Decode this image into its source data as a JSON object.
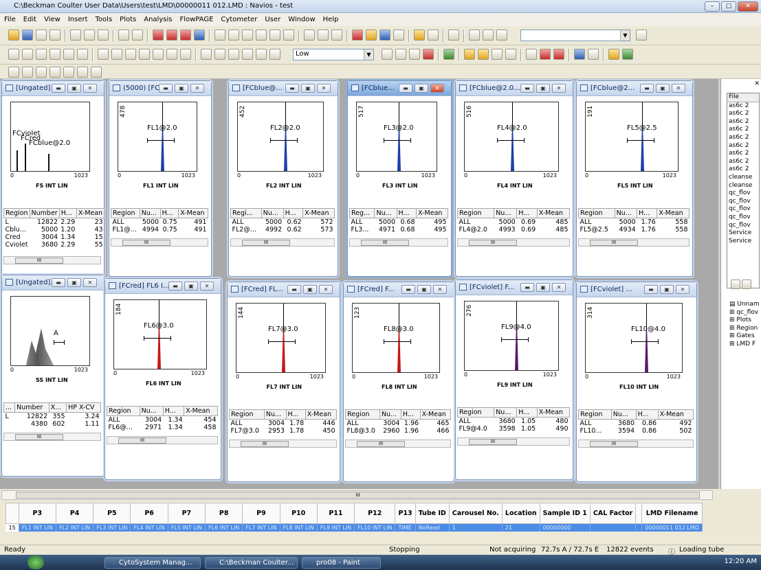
{
  "app": {
    "title": "C:\\Beckman Coulter User Data\\Users\\test\\LMD\\00000011 012.LMD : Navios - test"
  },
  "menu": [
    "File",
    "Edit",
    "View",
    "Insert",
    "Tools",
    "Plots",
    "Analysis",
    "FlowPAGE",
    "Cytometer",
    "User",
    "Window",
    "Help"
  ],
  "toolbar": {
    "speed": "Low"
  },
  "plots": [
    {
      "title": "[Ungated] ...",
      "xlabel": "FS INT LIN",
      "tick_max": "1023",
      "labels": [
        "FCviolet",
        "FCred",
        "FCblue@2.0"
      ],
      "headers": [
        "Region",
        "Number",
        "H...",
        "X-Mean"
      ],
      "rows": [
        [
          "L",
          "12822",
          "2.29",
          "23"
        ],
        [
          "Cblu...",
          "5000",
          "1.20",
          "43"
        ],
        [
          "Cred",
          "3004",
          "1.34",
          "15"
        ],
        [
          "Cviolet",
          "3680",
          "2.29",
          "55"
        ]
      ]
    },
    {
      "title": "(5000) [FCbl...",
      "ymax": "478",
      "region": "FL1@2.0",
      "xlabel": "FL1 INT LIN",
      "tick_max": "1023",
      "headers": [
        "Region",
        "Nu...",
        "H...",
        "X-Mean"
      ],
      "rows": [
        [
          "ALL",
          "5000",
          "0.75",
          "491"
        ],
        [
          "FL1@...",
          "4994",
          "0.75",
          "491"
        ]
      ],
      "color": "#1f3fa8"
    },
    {
      "title": "[FCblue@...",
      "ymax": "452",
      "region": "FL2@2.0",
      "xlabel": "FL2 INT LIN",
      "tick_max": "1023",
      "headers": [
        "Regi...",
        "Nu...",
        "H...",
        "X-Mean"
      ],
      "rows": [
        [
          "ALL",
          "5000",
          "0.62",
          "572"
        ],
        [
          "FL2@...",
          "4992",
          "0.62",
          "573"
        ]
      ],
      "color": "#1f3fa8"
    },
    {
      "title": "[FCblue...",
      "ymax": "517",
      "region": "FL3@2.0",
      "xlabel": "FL3 INT LIN",
      "tick_max": "1023",
      "headers": [
        "Reg...",
        "Nu...",
        "H...",
        "X-Mean"
      ],
      "rows": [
        [
          "ALL",
          "5000",
          "0.68",
          "495"
        ],
        [
          "FL3...",
          "4971",
          "0.68",
          "495"
        ]
      ],
      "color": "#1f3fa8"
    },
    {
      "title": "[FCblue@2.0...",
      "ymax": "516",
      "region": "FL4@2.0",
      "xlabel": "FL4 INT LIN",
      "tick_max": "1023",
      "headers": [
        "Region",
        "Nu...",
        "H...",
        "X-Mean"
      ],
      "rows": [
        [
          "ALL",
          "5000",
          "0.69",
          "485"
        ],
        [
          "FL4@2.0",
          "4993",
          "0.69",
          "485"
        ]
      ],
      "color": "#1f3fa8"
    },
    {
      "title": "[FCblue@2...",
      "ymax": "191",
      "region": "FL5@2.5",
      "xlabel": "FL5 INT LIN",
      "tick_max": "1023",
      "headers": [
        "Region",
        "Nu...",
        "H...",
        "X-Mean"
      ],
      "rows": [
        [
          "ALL",
          "5000",
          "1.76",
          "558"
        ],
        [
          "FL5@2.5",
          "4934",
          "1.76",
          "558"
        ]
      ],
      "color": "#1f3fa8"
    },
    {
      "title": "[Ungated]...",
      "xlabel": "SS INT LIN",
      "tick_max": "1023",
      "region": "A",
      "headers": [
        "...",
        "Number",
        "X...",
        "HP X-CV"
      ],
      "rows": [
        [
          "L",
          "12822",
          "355",
          "3.24"
        ],
        [
          "",
          "4380",
          "602",
          "1.11"
        ]
      ],
      "color": "#777777"
    },
    {
      "title": "[FCred] FL6 I...",
      "ymax": "184",
      "region": "FL6@3.0",
      "xlabel": "FL6 INT LIN",
      "tick_max": "1023",
      "headers": [
        "Region",
        "Nu...",
        "H...",
        "X-Mean"
      ],
      "rows": [
        [
          "ALL",
          "3004",
          "1.34",
          "454"
        ],
        [
          "FL6@...",
          "2971",
          "1.34",
          "458"
        ]
      ],
      "color": "#c41919"
    },
    {
      "title": "[FCred] FL...",
      "ymax": "144",
      "region": "FL7@3.0",
      "xlabel": "FL7 INT LIN",
      "tick_max": "1023",
      "headers": [
        "Region",
        "Nu...",
        "H...",
        "X-Mean"
      ],
      "rows": [
        [
          "ALL",
          "3004",
          "1.78",
          "446"
        ],
        [
          "FL7@3.0",
          "2953",
          "1.78",
          "450"
        ]
      ],
      "color": "#c41919"
    },
    {
      "title": "[FCred] F...",
      "ymax": "123",
      "region": "FL8@3.0",
      "xlabel": "FL8 INT LIN",
      "tick_max": "1023",
      "headers": [
        "Region",
        "Nu...",
        "H...",
        "X-Mean"
      ],
      "rows": [
        [
          "ALL",
          "3004",
          "1.96",
          "465"
        ],
        [
          "FL8@3.0",
          "2960",
          "1.96",
          "466"
        ]
      ],
      "color": "#c41919"
    },
    {
      "title": "[FCviolet] F...",
      "ymax": "276",
      "region": "FL9@4.0",
      "xlabel": "FL9 INT LIN",
      "tick_max": "1023",
      "headers": [
        "Region",
        "Nu...",
        "H...",
        "X-Mean"
      ],
      "rows": [
        [
          "ALL",
          "3680",
          "1.05",
          "480"
        ],
        [
          "FL9@4.0",
          "3598",
          "1.05",
          "490"
        ]
      ],
      "color": "#5a1a6e"
    },
    {
      "title": "[FCviolet] ...",
      "ymax": "314",
      "region": "FL10@4.0",
      "xlabel": "FL10 INT LIN",
      "tick_max": "1023",
      "headers": [
        "Region",
        "Nu...",
        "H...",
        "X-Mean"
      ],
      "rows": [
        [
          "ALL",
          "3680",
          "0.86",
          "492"
        ],
        [
          "FL10...",
          "3594",
          "0.86",
          "502"
        ]
      ],
      "color": "#5a1a6e"
    }
  ],
  "sidebar": {
    "header": "File",
    "files": [
      "as6c 2",
      "as6c 2",
      "as6c 2",
      "as6c 2",
      "as6c 2",
      "as6c 2",
      "as6c 2",
      "as6c 2",
      "as6c 2",
      "cleanse",
      "cleanse",
      "qc_flov",
      "qc_flov",
      "qc_flov",
      "qc_flov",
      "qc_flov",
      "Service",
      "Service"
    ],
    "tree": [
      "Unnam",
      "qc_flov",
      "Plots",
      "Region",
      "Gates",
      "LMD F"
    ]
  },
  "grid": {
    "headers": [
      "P3",
      "P4",
      "P5",
      "P6",
      "P7",
      "P8",
      "P9",
      "P10",
      "P11",
      "P12",
      "P13",
      "Tube ID",
      "Carousel No.",
      "Location",
      "Sample ID 1",
      "CAL Factor",
      "",
      "LMD Filename"
    ],
    "row_num": "15",
    "row": [
      "FL1 INT LIN",
      "FL2 INT LIN",
      "FL3 INT LIN",
      "FL4 INT LIN",
      "FL5 INT LIN",
      "FL6 INT LIN",
      "FL7 INT LIN",
      "FL8 INT LIN",
      "FL9 INT LIN",
      "FL10 INT LIN",
      "TIME",
      "NoRead",
      "1",
      "21",
      "00000000",
      "",
      "",
      "00000011 012.LMD"
    ]
  },
  "status": {
    "ready": "Ready",
    "stopping": "Stopping",
    "acquiring": "Not acquiring",
    "temp": "72.7s A / 72.7s E",
    "events": "12822 events",
    "loading": "Loading tube"
  },
  "taskbar": {
    "items": [
      "CytoSystem Manag...",
      "C:\\Beckman Coulter...",
      "pro08 - Paint"
    ],
    "clock": "12:20 AM"
  }
}
